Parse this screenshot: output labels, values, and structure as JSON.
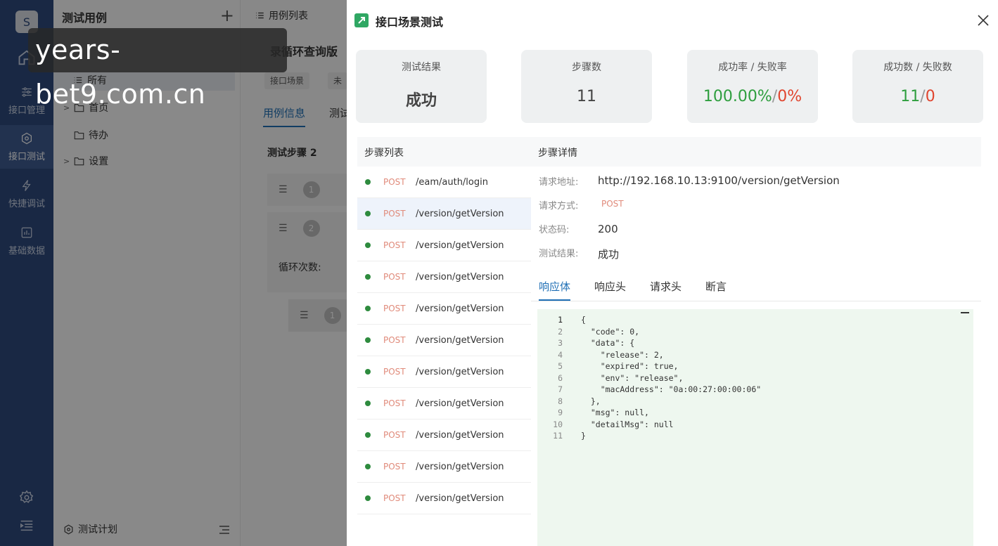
{
  "nav": {
    "logo_letter": "S",
    "items": [
      {
        "label": "接口管理",
        "icon": "sliders-icon"
      },
      {
        "label": "接口测试",
        "icon": "hexagon-gear-icon"
      },
      {
        "label": "快捷调试",
        "icon": "lightning-icon"
      },
      {
        "label": "基础数据",
        "icon": "bar-chart-icon"
      }
    ]
  },
  "tree": {
    "title": "测试用例",
    "add_symbol": "+",
    "items": [
      {
        "label": "所有"
      },
      {
        "label": "首页"
      },
      {
        "label": "待办"
      },
      {
        "label": "设置"
      }
    ],
    "footer_label": "测试计划"
  },
  "middle": {
    "toolbar_label": "用例列表",
    "case_title": "录循环查询版",
    "tags": [
      "接口场景",
      "未"
    ],
    "tabs": [
      "用例信息",
      "测试"
    ],
    "steps_title": "测试步骤 2",
    "step_numbers": [
      "1",
      "2",
      "1"
    ],
    "loop_label": "循环次数:"
  },
  "watermark": "years-bet9.com.cn",
  "drawer": {
    "title": "接口场景测试",
    "stats": {
      "result_label": "测试结果",
      "result_value": "成功",
      "steps_label": "步骤数",
      "steps_value": "11",
      "rate_label": "成功率 / 失败率",
      "success_rate": "100.00%",
      "fail_rate": "0%",
      "count_label": "成功数 / 失败数",
      "success_count": "11",
      "fail_count": "0",
      "separator": "/"
    },
    "step_list_title": "步骤列表",
    "steps": [
      {
        "method": "POST",
        "path": "/eam/auth/login"
      },
      {
        "method": "POST",
        "path": "/version/getVersion"
      },
      {
        "method": "POST",
        "path": "/version/getVersion"
      },
      {
        "method": "POST",
        "path": "/version/getVersion"
      },
      {
        "method": "POST",
        "path": "/version/getVersion"
      },
      {
        "method": "POST",
        "path": "/version/getVersion"
      },
      {
        "method": "POST",
        "path": "/version/getVersion"
      },
      {
        "method": "POST",
        "path": "/version/getVersion"
      },
      {
        "method": "POST",
        "path": "/version/getVersion"
      },
      {
        "method": "POST",
        "path": "/version/getVersion"
      },
      {
        "method": "POST",
        "path": "/version/getVersion"
      }
    ],
    "detail": {
      "title": "步骤详情",
      "url_label": "请求地址:",
      "url": "http://192.168.10.13:9100/version/getVersion",
      "method_label": "请求方式:",
      "method": "POST",
      "status_label": "状态码:",
      "status": "200",
      "result_label": "测试结果:",
      "result": "成功",
      "tabs": [
        "响应体",
        "响应头",
        "请求头",
        "断言"
      ]
    },
    "response_lines": [
      "{",
      "  \"code\": 0,",
      "  \"data\": {",
      "    \"release\": 2,",
      "    \"expired\": true,",
      "    \"env\": \"release\",",
      "    \"macAddress\": \"0a:00:27:00:00:06\"",
      "  },",
      "  \"msg\": null,",
      "  \"detailMsg\": null",
      "}"
    ]
  }
}
